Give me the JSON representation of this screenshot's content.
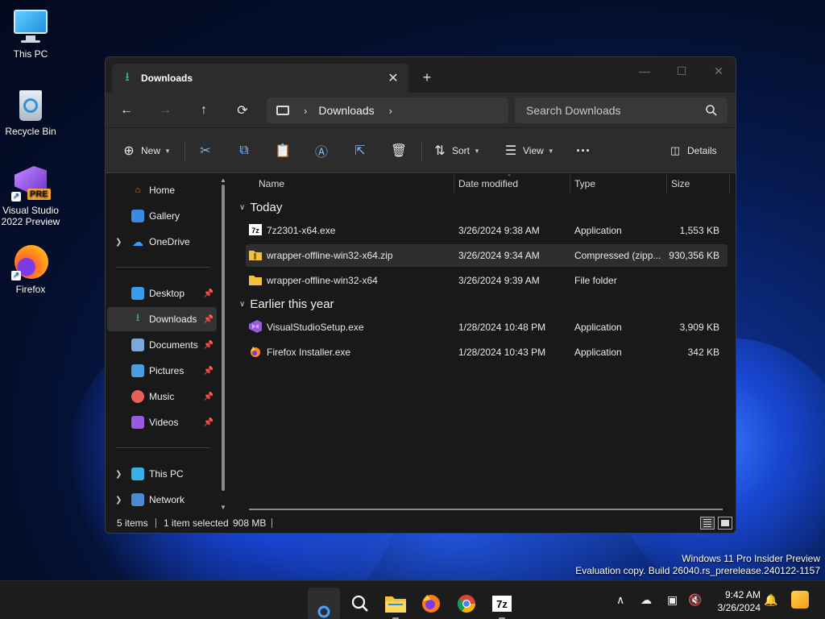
{
  "desktop": {
    "icons": [
      {
        "label": "This PC"
      },
      {
        "label": "Recycle Bin"
      },
      {
        "label": "Visual Studio 2022 Preview",
        "badge": "PRE"
      },
      {
        "label": "Firefox"
      }
    ],
    "watermark": {
      "line1": "Windows 11 Pro Insider Preview",
      "line2": "Evaluation copy. Build 26040.rs_prerelease.240122-1157"
    }
  },
  "explorer": {
    "tab_title": "Downloads",
    "address": {
      "crumb": "Downloads"
    },
    "search": {
      "placeholder": "Search Downloads"
    },
    "commands": {
      "new": "New",
      "sort": "Sort",
      "view": "View",
      "details": "Details"
    },
    "sidebar": {
      "home": "Home",
      "gallery": "Gallery",
      "onedrive": "OneDrive",
      "desktop": "Desktop",
      "downloads": "Downloads",
      "documents": "Documents",
      "pictures": "Pictures",
      "music": "Music",
      "videos": "Videos",
      "thispc": "This PC",
      "network": "Network"
    },
    "columns": {
      "name": "Name",
      "date": "Date modified",
      "type": "Type",
      "size": "Size"
    },
    "groups": {
      "today": "Today",
      "earlier": "Earlier this year"
    },
    "files": [
      {
        "name": "7z2301-x64.exe",
        "date": "3/26/2024 9:38 AM",
        "type": "Application",
        "size": "1,553 KB",
        "icon": "7zip-icon"
      },
      {
        "name": "wrapper-offline-win32-x64.zip",
        "date": "3/26/2024 9:34 AM",
        "type": "Compressed (zipp...",
        "size": "930,356 KB",
        "icon": "zip-folder-icon"
      },
      {
        "name": "wrapper-offline-win32-x64",
        "date": "3/26/2024 9:39 AM",
        "type": "File folder",
        "size": "",
        "icon": "folder-icon"
      },
      {
        "name": "VisualStudioSetup.exe",
        "date": "1/28/2024 10:48 PM",
        "type": "Application",
        "size": "3,909 KB",
        "icon": "visual-studio-icon"
      },
      {
        "name": "Firefox Installer.exe",
        "date": "1/28/2024 10:43 PM",
        "type": "Application",
        "size": "342 KB",
        "icon": "firefox-icon"
      }
    ],
    "status": {
      "items": "5 items",
      "selected": "1 item selected",
      "size": "908 MB"
    }
  },
  "taskbar": {
    "time": "9:42 AM",
    "date": "3/26/2024",
    "sevenzip_label": "7z"
  },
  "colors": {
    "accent": "#0067c0",
    "folder": "#f3c13a",
    "download_green": "#3ec08a"
  }
}
